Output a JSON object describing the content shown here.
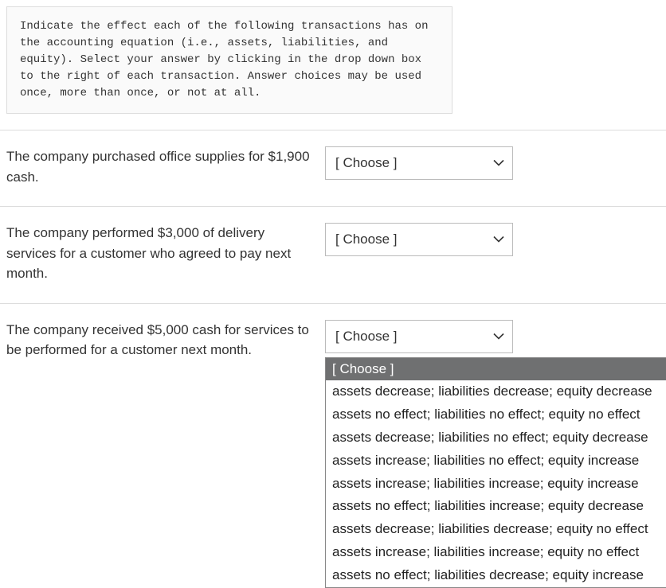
{
  "prompt": "Indicate the effect each of the following transactions has on the accounting equation (i.e., assets, liabilities, and equity). Select your answer by clicking in the drop down box to the right of each transaction. Answer choices may be used once, more than once, or not at all.",
  "choose_placeholder": "[ Choose ]",
  "rows": [
    {
      "label": "The company purchased office supplies for $1,900 cash."
    },
    {
      "label": "The company performed $3,000 of delivery services for a customer who agreed to pay next month."
    },
    {
      "label": "The company received $5,000 cash for services to be performed for a customer next month."
    }
  ],
  "dropdown_options": [
    "[ Choose ]",
    "assets decrease; liabilities decrease; equity decrease",
    "assets no effect; liabilities no effect; equity no effect",
    "assets decrease; liabilities no effect; equity decrease",
    "assets increase; liabilities no effect; equity increase",
    "assets increase; liabilities increase; equity increase",
    "assets no effect; liabilities increase; equity decrease",
    "assets decrease; liabilities decrease; equity no effect",
    "assets increase; liabilities increase; equity no effect",
    "assets no effect; liabilities decrease; equity increase"
  ]
}
